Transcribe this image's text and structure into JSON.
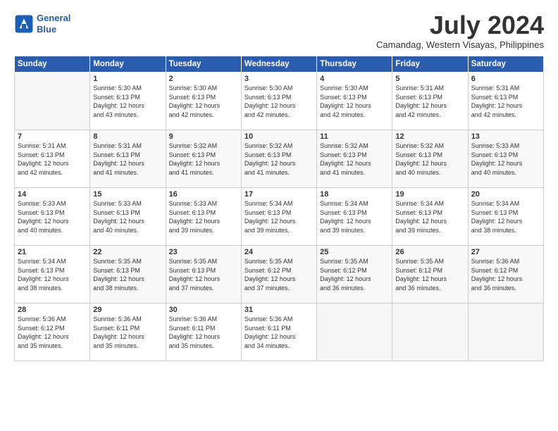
{
  "logo": {
    "line1": "General",
    "line2": "Blue"
  },
  "title": "July 2024",
  "location": "Camandag, Western Visayas, Philippines",
  "weekdays": [
    "Sunday",
    "Monday",
    "Tuesday",
    "Wednesday",
    "Thursday",
    "Friday",
    "Saturday"
  ],
  "weeks": [
    [
      {
        "day": "",
        "info": ""
      },
      {
        "day": "1",
        "info": "Sunrise: 5:30 AM\nSunset: 6:13 PM\nDaylight: 12 hours\nand 43 minutes."
      },
      {
        "day": "2",
        "info": "Sunrise: 5:30 AM\nSunset: 6:13 PM\nDaylight: 12 hours\nand 42 minutes."
      },
      {
        "day": "3",
        "info": "Sunrise: 5:30 AM\nSunset: 6:13 PM\nDaylight: 12 hours\nand 42 minutes."
      },
      {
        "day": "4",
        "info": "Sunrise: 5:30 AM\nSunset: 6:13 PM\nDaylight: 12 hours\nand 42 minutes."
      },
      {
        "day": "5",
        "info": "Sunrise: 5:31 AM\nSunset: 6:13 PM\nDaylight: 12 hours\nand 42 minutes."
      },
      {
        "day": "6",
        "info": "Sunrise: 5:31 AM\nSunset: 6:13 PM\nDaylight: 12 hours\nand 42 minutes."
      }
    ],
    [
      {
        "day": "7",
        "info": "Sunrise: 5:31 AM\nSunset: 6:13 PM\nDaylight: 12 hours\nand 42 minutes."
      },
      {
        "day": "8",
        "info": "Sunrise: 5:31 AM\nSunset: 6:13 PM\nDaylight: 12 hours\nand 41 minutes."
      },
      {
        "day": "9",
        "info": "Sunrise: 5:32 AM\nSunset: 6:13 PM\nDaylight: 12 hours\nand 41 minutes."
      },
      {
        "day": "10",
        "info": "Sunrise: 5:32 AM\nSunset: 6:13 PM\nDaylight: 12 hours\nand 41 minutes."
      },
      {
        "day": "11",
        "info": "Sunrise: 5:32 AM\nSunset: 6:13 PM\nDaylight: 12 hours\nand 41 minutes."
      },
      {
        "day": "12",
        "info": "Sunrise: 5:32 AM\nSunset: 6:13 PM\nDaylight: 12 hours\nand 40 minutes."
      },
      {
        "day": "13",
        "info": "Sunrise: 5:33 AM\nSunset: 6:13 PM\nDaylight: 12 hours\nand 40 minutes."
      }
    ],
    [
      {
        "day": "14",
        "info": "Sunrise: 5:33 AM\nSunset: 6:13 PM\nDaylight: 12 hours\nand 40 minutes."
      },
      {
        "day": "15",
        "info": "Sunrise: 5:33 AM\nSunset: 6:13 PM\nDaylight: 12 hours\nand 40 minutes."
      },
      {
        "day": "16",
        "info": "Sunrise: 5:33 AM\nSunset: 6:13 PM\nDaylight: 12 hours\nand 39 minutes."
      },
      {
        "day": "17",
        "info": "Sunrise: 5:34 AM\nSunset: 6:13 PM\nDaylight: 12 hours\nand 39 minutes."
      },
      {
        "day": "18",
        "info": "Sunrise: 5:34 AM\nSunset: 6:13 PM\nDaylight: 12 hours\nand 39 minutes."
      },
      {
        "day": "19",
        "info": "Sunrise: 5:34 AM\nSunset: 6:13 PM\nDaylight: 12 hours\nand 39 minutes."
      },
      {
        "day": "20",
        "info": "Sunrise: 5:34 AM\nSunset: 6:13 PM\nDaylight: 12 hours\nand 38 minutes."
      }
    ],
    [
      {
        "day": "21",
        "info": "Sunrise: 5:34 AM\nSunset: 6:13 PM\nDaylight: 12 hours\nand 38 minutes."
      },
      {
        "day": "22",
        "info": "Sunrise: 5:35 AM\nSunset: 6:13 PM\nDaylight: 12 hours\nand 38 minutes."
      },
      {
        "day": "23",
        "info": "Sunrise: 5:35 AM\nSunset: 6:13 PM\nDaylight: 12 hours\nand 37 minutes."
      },
      {
        "day": "24",
        "info": "Sunrise: 5:35 AM\nSunset: 6:12 PM\nDaylight: 12 hours\nand 37 minutes."
      },
      {
        "day": "25",
        "info": "Sunrise: 5:35 AM\nSunset: 6:12 PM\nDaylight: 12 hours\nand 36 minutes."
      },
      {
        "day": "26",
        "info": "Sunrise: 5:35 AM\nSunset: 6:12 PM\nDaylight: 12 hours\nand 36 minutes."
      },
      {
        "day": "27",
        "info": "Sunrise: 5:36 AM\nSunset: 6:12 PM\nDaylight: 12 hours\nand 36 minutes."
      }
    ],
    [
      {
        "day": "28",
        "info": "Sunrise: 5:36 AM\nSunset: 6:12 PM\nDaylight: 12 hours\nand 35 minutes."
      },
      {
        "day": "29",
        "info": "Sunrise: 5:36 AM\nSunset: 6:11 PM\nDaylight: 12 hours\nand 35 minutes."
      },
      {
        "day": "30",
        "info": "Sunrise: 5:36 AM\nSunset: 6:11 PM\nDaylight: 12 hours\nand 35 minutes."
      },
      {
        "day": "31",
        "info": "Sunrise: 5:36 AM\nSunset: 6:11 PM\nDaylight: 12 hours\nand 34 minutes."
      },
      {
        "day": "",
        "info": ""
      },
      {
        "day": "",
        "info": ""
      },
      {
        "day": "",
        "info": ""
      }
    ]
  ]
}
